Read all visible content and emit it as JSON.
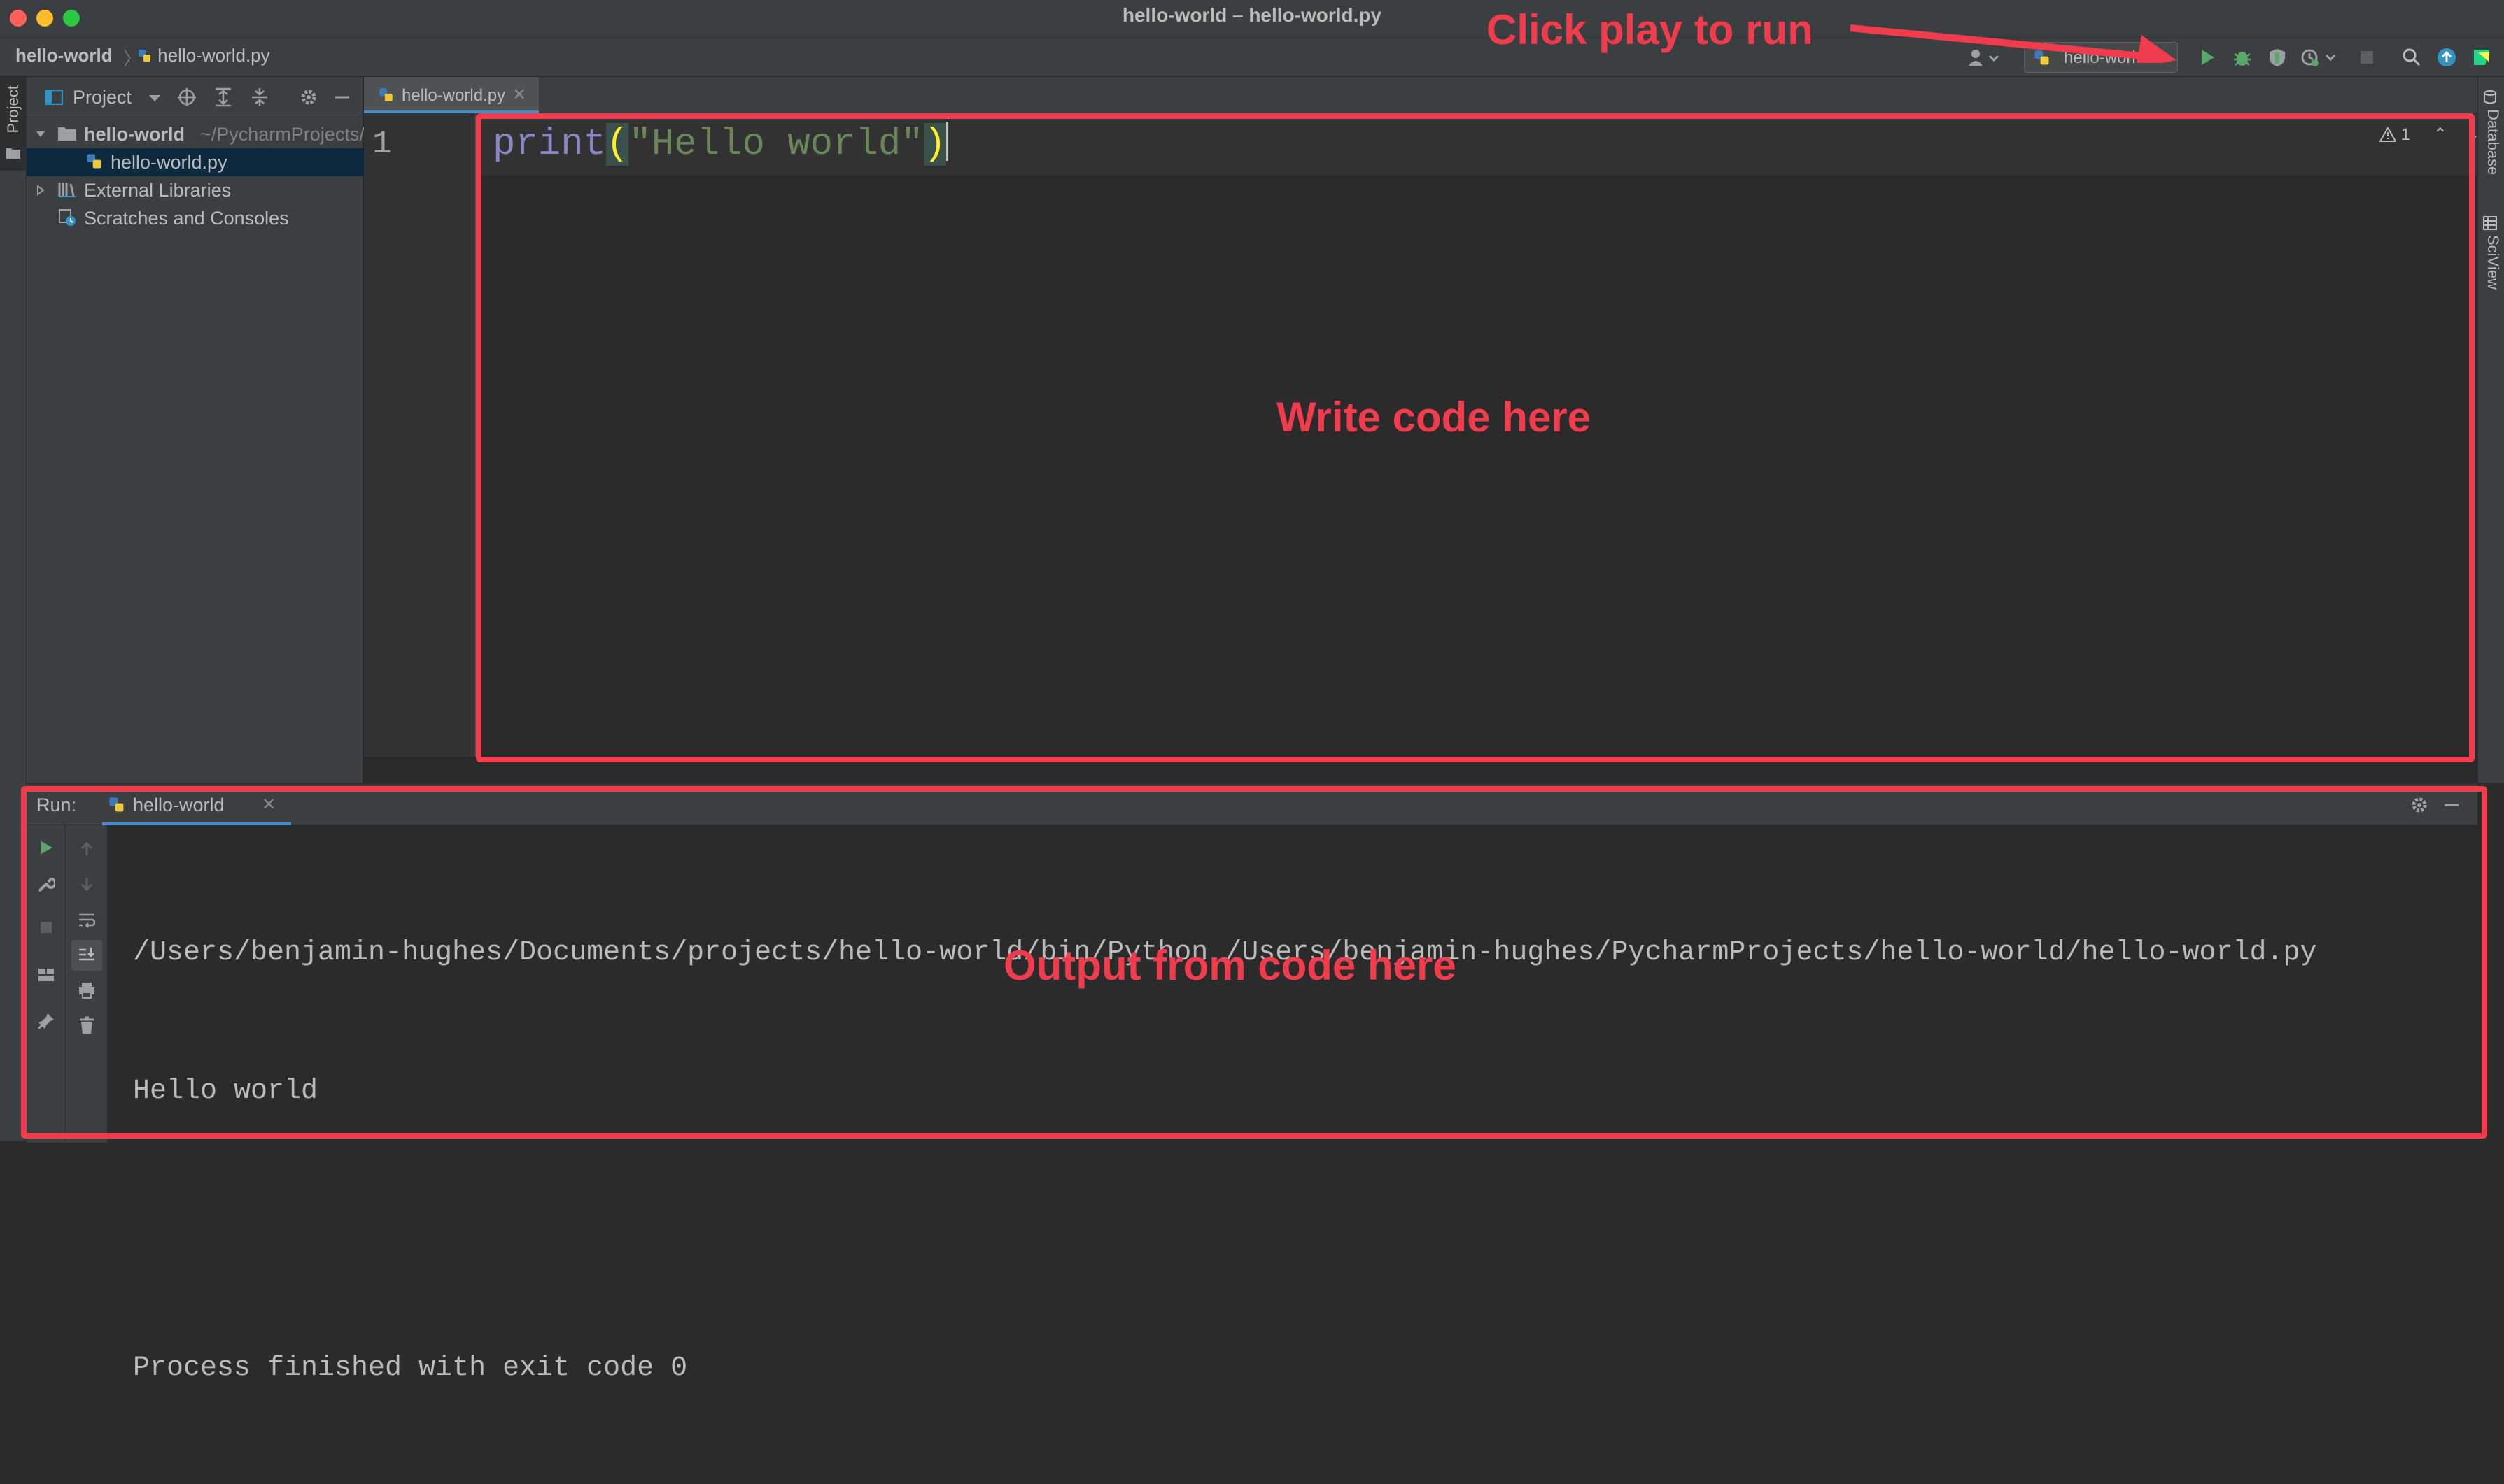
{
  "window": {
    "title": "hello-world – hello-world.py",
    "traffic_lights": [
      "#ff5f57",
      "#febc2e",
      "#28c840"
    ]
  },
  "navbar": {
    "project": "hello-world",
    "file": "hello-world.py",
    "run_config": "hello-worl"
  },
  "left_stripe": {
    "project_label": "Project"
  },
  "right_stripe": {
    "database_label": "Database",
    "sciview_label": "SciView"
  },
  "project_panel": {
    "title": "Project",
    "tree": [
      {
        "name": "hello-world",
        "path": "~/PycharmProjects/hello-world"
      },
      {
        "name": "hello-world.py"
      },
      {
        "name": "External Libraries"
      },
      {
        "name": "Scratches and Consoles"
      }
    ]
  },
  "editor": {
    "tab_label": "hello-world.py",
    "line_number": "1",
    "code": {
      "func": "print",
      "open_paren": "(",
      "string": "\"Hello world\"",
      "close_paren": ")"
    },
    "warning_count": "1"
  },
  "run_panel": {
    "label": "Run:",
    "tab_label": "hello-world",
    "output": [
      "/Users/benjamin-hughes/Documents/projects/hello-world/bin/Python /Users/benjamin-hughes/PycharmProjects/hello-world/hello-world.py",
      "Hello world",
      "",
      "Process finished with exit code 0"
    ]
  },
  "annotations": {
    "run_hint": "Click play to run",
    "editor_hint": "Write code here",
    "output_hint": "Output from code here",
    "color": "#f03c4d"
  },
  "colors": {
    "accent": "#4a88c7",
    "run_green": "#59a869",
    "keyword_purple": "#a9b7c6",
    "string_green": "#6a8759",
    "paren_yellow": "#ffef28"
  }
}
